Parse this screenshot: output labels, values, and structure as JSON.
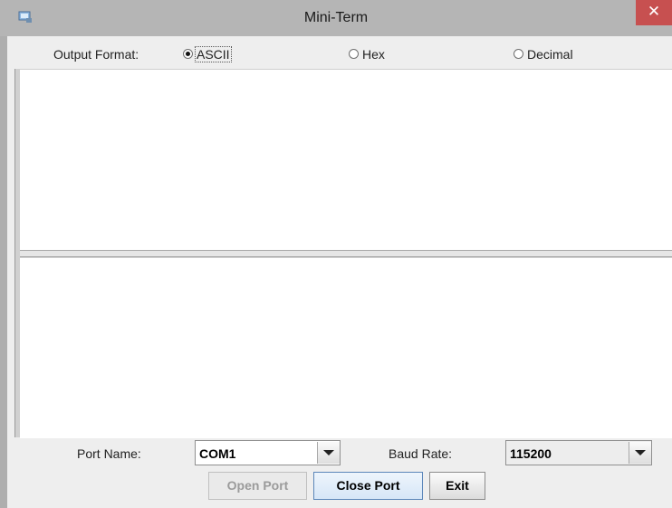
{
  "window": {
    "title": "Mini-Term",
    "close_symbol": "✕",
    "icon": "app-icon"
  },
  "output_format": {
    "label": "Output Format:",
    "options": [
      {
        "label": "ASCII",
        "selected": true
      },
      {
        "label": "Hex",
        "selected": false
      },
      {
        "label": "Decimal",
        "selected": false
      }
    ]
  },
  "receive_area": {
    "text": ""
  },
  "send_area": {
    "text": ""
  },
  "port": {
    "name_label": "Port Name:",
    "name_value": "COM1",
    "baud_label": "Baud Rate:",
    "baud_value": "115200"
  },
  "buttons": {
    "open_port": "Open Port",
    "close_port": "Close Port",
    "exit": "Exit"
  },
  "colors": {
    "close_button": "#c75050",
    "title_bar": "#b5b5b5"
  }
}
